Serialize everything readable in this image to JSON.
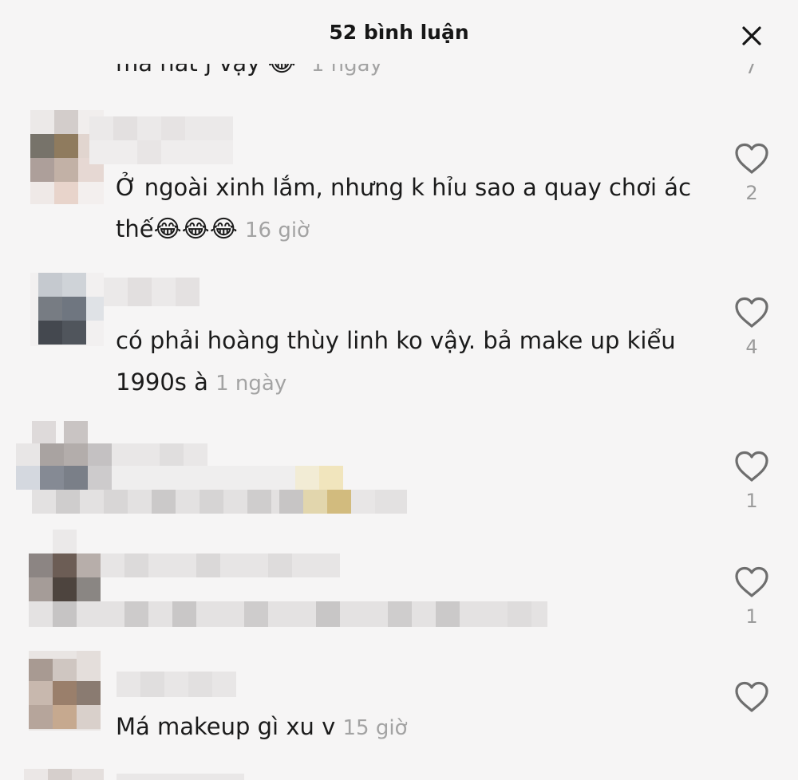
{
  "header": {
    "title": "52 bình luận"
  },
  "partial_comment": {
    "text": "má hát j vậy",
    "emoji": "😂",
    "time": "1 ngày",
    "likes": "7"
  },
  "comments": [
    {
      "text": "Ở ngoài xinh lắm, nhưng k hỉu sao a quay chơi ác thế",
      "emoji": "😂😂😂",
      "time": "16 giờ",
      "likes": "2"
    },
    {
      "text": "có phải hoàng thùy linh ko vậy. bả make up kiểu 1990s à",
      "time": "1 ngày",
      "likes": "4"
    },
    {
      "likes": "1"
    },
    {
      "likes": "1"
    },
    {
      "text": "Má makeup gì xu v",
      "time": "15 giờ",
      "likes": ""
    }
  ],
  "icons": {
    "close": "close-icon",
    "like": "heart-outline-icon"
  },
  "colors": {
    "background": "#f6f5f5",
    "timestamp": "#a3a3a3",
    "count": "#9b9b9b"
  }
}
